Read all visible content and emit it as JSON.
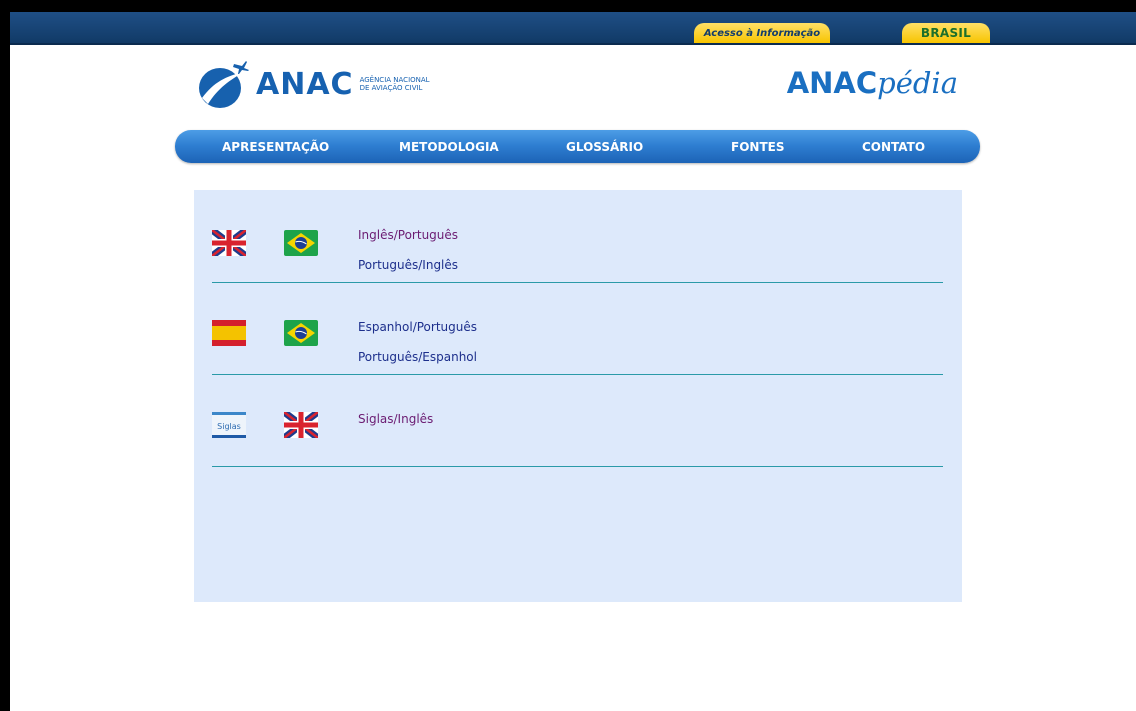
{
  "gov_bar": {
    "access_label": "Acesso à Informação",
    "brasil_label": "BRASIL"
  },
  "header": {
    "logo_text": "ANAC",
    "logo_sub_line1": "AGÊNCIA NACIONAL",
    "logo_sub_line2": "DE AVIAÇÃO CIVIL",
    "title_bold": "ANAC",
    "title_italic": "pédia"
  },
  "nav": {
    "items": [
      {
        "label": "APRESENTAÇÃO"
      },
      {
        "label": "METODOLOGIA"
      },
      {
        "label": "GLOSSÁRIO"
      },
      {
        "label": "FONTES"
      },
      {
        "label": "CONTATO"
      }
    ]
  },
  "dictionaries": [
    {
      "flags": [
        "uk-flag-icon",
        "brazil-flag-icon"
      ],
      "links": [
        "Inglês/Português",
        "Português/Inglês"
      ]
    },
    {
      "flags": [
        "spain-flag-icon",
        "brazil-flag-icon"
      ],
      "links": [
        "Espanhol/Português",
        "Português/Espanhol"
      ]
    },
    {
      "flags": [
        "siglas-icon",
        "uk-flag-icon"
      ],
      "siglas_text": "Siglas",
      "links": [
        "Siglas/Inglês"
      ]
    }
  ],
  "colors": {
    "gov_bar": "#1f4f86",
    "accent_yellow": "#f7c400",
    "nav_blue": "#2f7fd2",
    "panel_bg": "#dde9fb",
    "rule": "#2a9aa8"
  }
}
